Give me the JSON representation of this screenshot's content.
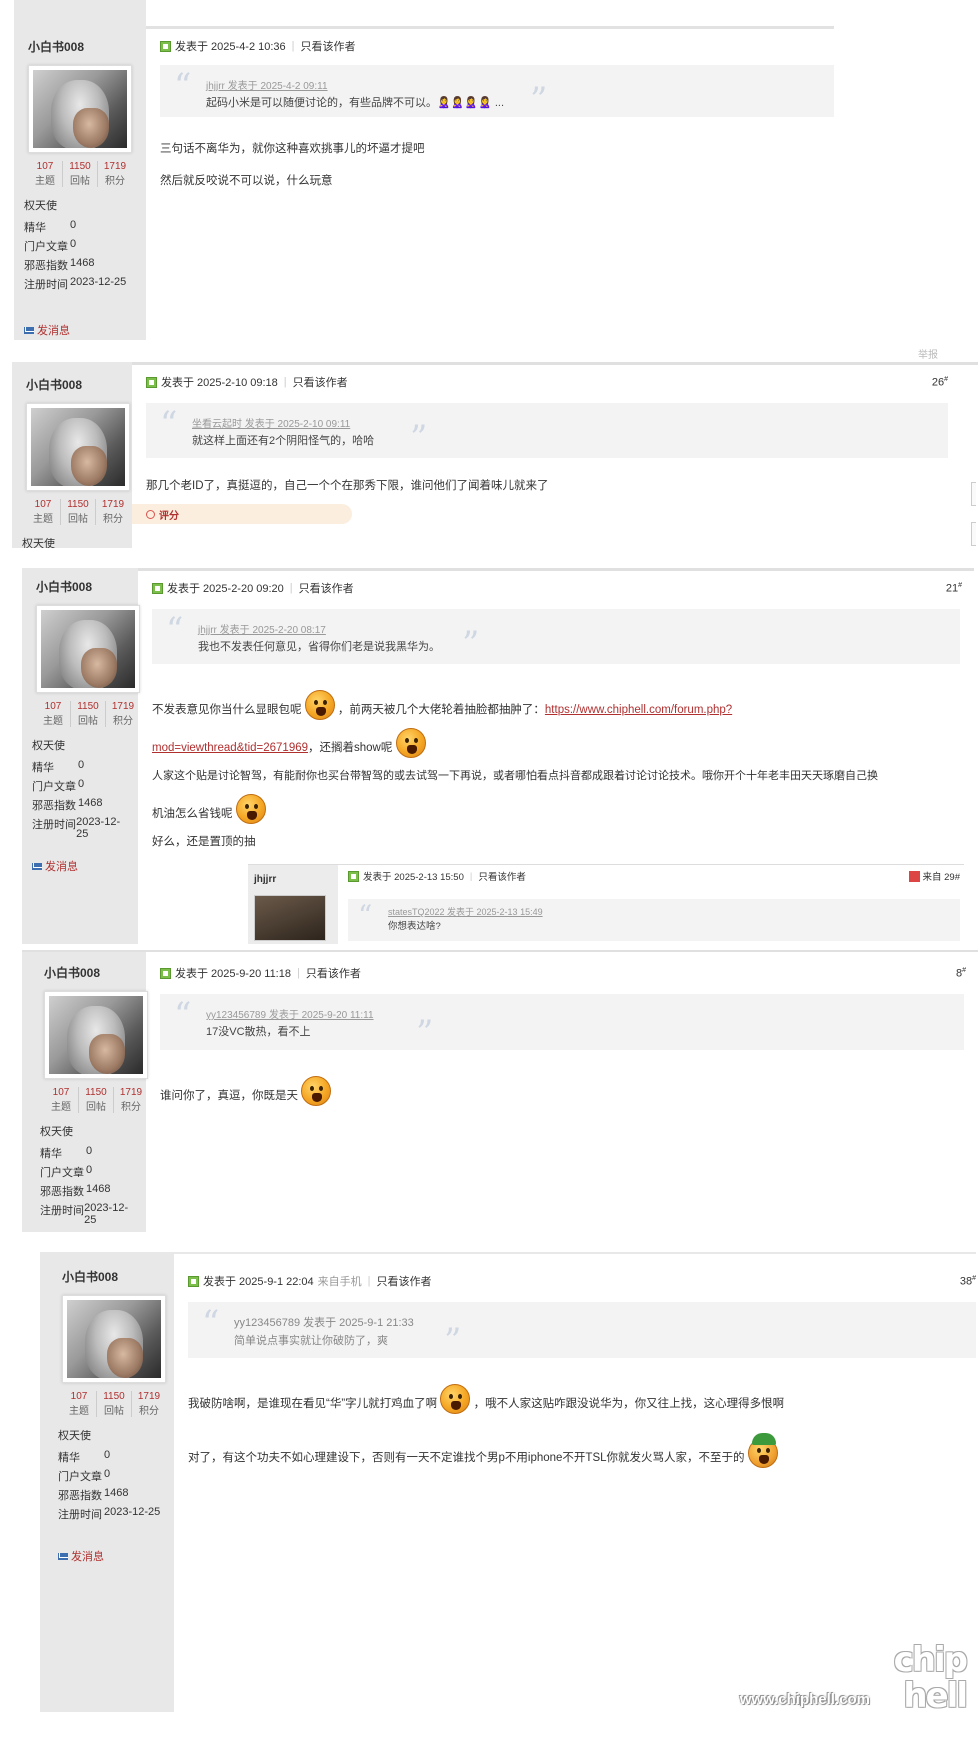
{
  "user": {
    "name": "小白书008",
    "stats": [
      {
        "value": "107",
        "label": "主题"
      },
      {
        "value": "1150",
        "label": "回帖"
      },
      {
        "value": "1719",
        "label": "积分"
      }
    ],
    "rank": "权天使",
    "info": [
      {
        "key": "精华",
        "value": "0"
      },
      {
        "key": "门户文章",
        "value": "0"
      },
      {
        "key": "邪恶指数",
        "value": "1468"
      },
      {
        "key": "注册时间",
        "value": "2023-12-25"
      }
    ],
    "message_link": "发消息"
  },
  "common": {
    "only_author": "只看该作者",
    "rate_label": "评分",
    "report_label": "举报"
  },
  "posts": [
    {
      "posted": "发表于 2025-4-2 10:36",
      "floor": "",
      "quote_source": "jhjjrr 发表于 2025-4-2 09:11",
      "quote_text": "起码小米是可以随便讨论的，有些品牌不可以。🙎‍♀️🙎‍♀️🙎‍♀️🙎‍♀️ ...",
      "lines": [
        "三句话不离华为，就你这种喜欢挑事儿的坏逼才提吧",
        "然后就反咬说不可以说，什么玩意"
      ]
    },
    {
      "posted": "发表于 2025-2-10 09:18",
      "floor": "26",
      "quote_source": "坐看云起时 发表于 2025-2-10 09:11",
      "quote_text": "就这样上面还有2个阴阳怪气的，哈哈",
      "lines": [
        "那几个老ID了，真挺逗的，自己一个个在那秀下限，谁问他们了闻着味儿就来了"
      ]
    },
    {
      "posted": "发表于 2025-2-20 09:20",
      "floor": "21",
      "quote_source": "jhjjrr 发表于 2025-2-20 08:17",
      "quote_text": "我也不发表任何意见，省得你们老是说我黑华为。",
      "line1_pre": "不发表意见你当什么显眼包呢",
      "line1_mid": "，前两天被几个大佬轮着抽脸都抽肿了：",
      "link_part1": "https://www.chiphell.com/forum.php?",
      "link_part2": "mod=viewthread&tid=2671969",
      "line2_post": "，还搁着show呢",
      "line3": "人家这个贴是讨论智驾，有能耐你也买台带智驾的或去试驾一下再说，或者哪怕看点抖音都成跟着讨论讨论技术。哦你开个十年老丰田天天琢磨自己换",
      "line4": "机油怎么省钱呢",
      "line5": "好么，还是置顶的抽",
      "nested": {
        "name": "jhjjrr",
        "posted": "发表于 2025-2-13 15:50",
        "from": "来自 29#",
        "quote_source": "statesTQ2022 发表于 2025-2-13 15:49",
        "quote_text": "你想表达啥?"
      }
    },
    {
      "posted": "发表于 2025-9-20 11:18",
      "floor": "8",
      "quote_source": "yy123456789 发表于 2025-9-20 11:11",
      "quote_text": "17没VC散热，看不上",
      "lines": [
        "谁问你了，真逗，你既是天"
      ]
    },
    {
      "posted": "发表于 2025-9-1 22:04",
      "mobile": "来自手机",
      "floor": "38",
      "quote_source": "yy123456789 发表于 2025-9-1 21:33",
      "quote_text": "简单说点事实就让你破防了，爽",
      "line1_pre": "我破防啥啊，是谁现在看见“华”字儿就打鸡血了啊",
      "line1_post": "，哦不人家这贴咋跟没说华为，你又往上找，这心理得多恨啊",
      "line2": "对了，有这个功夫不如心理建设下，否则有一天不定谁找个男p不用iphone不开TSL你就发火骂人家，不至于的"
    }
  ],
  "watermark": {
    "url": "www.chiphell.com",
    "logo": "chip hell"
  },
  "icons": [
    "post-icon",
    "mail-icon",
    "quote-icon",
    "emoji-icon",
    "rate-icon"
  ]
}
